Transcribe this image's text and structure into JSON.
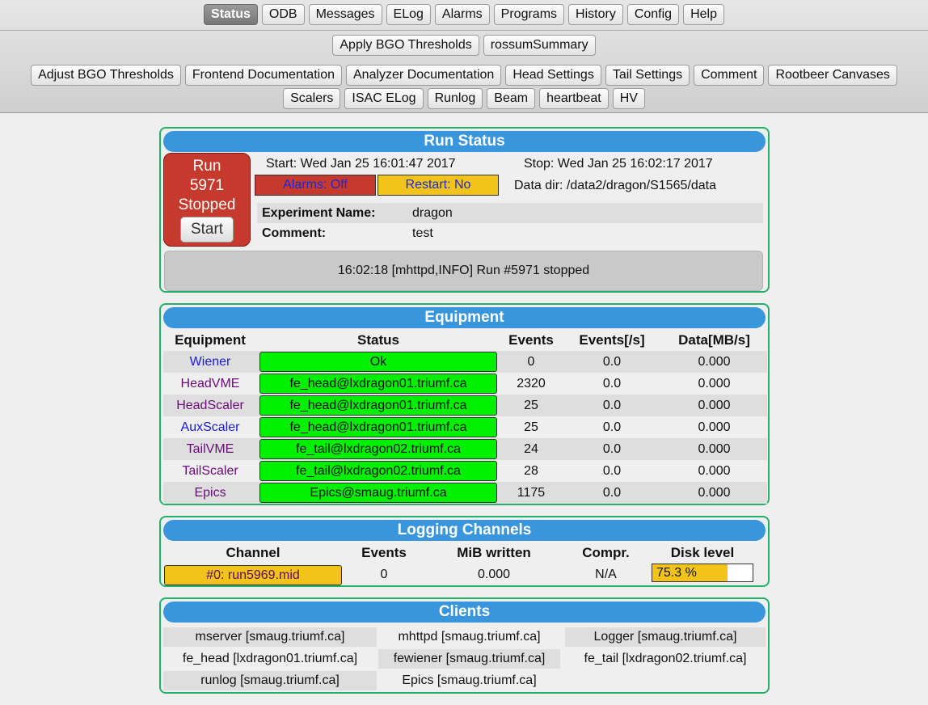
{
  "nav": {
    "main": [
      "Status",
      "ODB",
      "Messages",
      "ELog",
      "Alarms",
      "Programs",
      "History",
      "Config",
      "Help"
    ],
    "row2": [
      "Apply BGO Thresholds",
      "rossumSummary"
    ],
    "row3": [
      "Adjust BGO Thresholds",
      "Frontend Documentation",
      "Analyzer Documentation",
      "Head Settings",
      "Tail Settings",
      "Comment",
      "Rootbeer Canvases"
    ],
    "row4": [
      "Scalers",
      "ISAC ELog",
      "Runlog",
      "Beam",
      "heartbeat",
      "HV"
    ]
  },
  "run_status": {
    "title": "Run Status",
    "run_label": "Run",
    "run_number": "5971",
    "state": "Stopped",
    "start_button": "Start",
    "start_time": "Start: Wed Jan 25 16:01:47 2017",
    "stop_time": "Stop: Wed Jan 25 16:02:17 2017",
    "alarms": "Alarms: Off",
    "restart": "Restart: No",
    "data_dir": "Data dir: /data2/dragon/S1565/data",
    "experiment_label": "Experiment Name:",
    "experiment_value": "dragon",
    "comment_label": "Comment:",
    "comment_value": "test",
    "message": "16:02:18 [mhttpd,INFO] Run #5971 stopped",
    "colors": {
      "stopped": "#c53a2c",
      "alarms": "#c53a2c",
      "restart": "#f2c318"
    }
  },
  "equipment": {
    "title": "Equipment",
    "headers": [
      "Equipment",
      "Status",
      "Events",
      "Events[/s]",
      "Data[MB/s]"
    ],
    "rows": [
      {
        "name": "Wiener",
        "status": "Ok",
        "events": "0",
        "rate": "0.0",
        "data": "0.000"
      },
      {
        "name": "HeadVME",
        "status": "fe_head@lxdragon01.triumf.ca",
        "events": "2320",
        "rate": "0.0",
        "data": "0.000"
      },
      {
        "name": "HeadScaler",
        "status": "fe_head@lxdragon01.triumf.ca",
        "events": "25",
        "rate": "0.0",
        "data": "0.000"
      },
      {
        "name": "AuxScaler",
        "status": "fe_head@lxdragon01.triumf.ca",
        "events": "25",
        "rate": "0.0",
        "data": "0.000"
      },
      {
        "name": "TailVME",
        "status": "fe_tail@lxdragon02.triumf.ca",
        "events": "24",
        "rate": "0.0",
        "data": "0.000"
      },
      {
        "name": "TailScaler",
        "status": "fe_tail@lxdragon02.triumf.ca",
        "events": "28",
        "rate": "0.0",
        "data": "0.000"
      },
      {
        "name": "Epics",
        "status": "Epics@smaug.triumf.ca",
        "events": "1175",
        "rate": "0.0",
        "data": "0.000"
      }
    ],
    "colors": {
      "ok": "#00f000"
    }
  },
  "logging": {
    "title": "Logging Channels",
    "headers": [
      "Channel",
      "Events",
      "MiB written",
      "Compr.",
      "Disk level"
    ],
    "rows": [
      {
        "channel": "#0: run5969.mid",
        "events": "0",
        "mib": "0.000",
        "compr": "N/A",
        "disk": "75.3 %",
        "disk_fraction": 0.753
      }
    ]
  },
  "clients": {
    "title": "Clients",
    "items": [
      "mserver [smaug.triumf.ca]",
      "mhttpd [smaug.triumf.ca]",
      "Logger [smaug.triumf.ca]",
      "fe_head [lxdragon01.triumf.ca]",
      "fewiener [smaug.triumf.ca]",
      "fe_tail [lxdragon02.triumf.ca]",
      "runlog [smaug.triumf.ca]",
      "Epics [smaug.triumf.ca]"
    ]
  }
}
